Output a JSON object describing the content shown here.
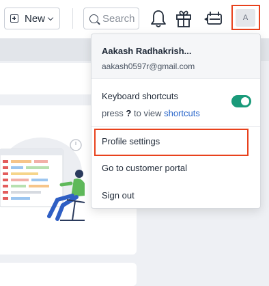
{
  "topbar": {
    "new_label": "New",
    "search_placeholder": "Search",
    "avatar_initial": "A",
    "icons": [
      "plus-square-icon",
      "chevron-down-icon",
      "search-icon",
      "bell-icon",
      "gift-icon",
      "announcement-icon"
    ]
  },
  "menu": {
    "user_name": "Aakash Radhakrish...",
    "user_email": "aakash0597r@gmail.com",
    "keyboard_shortcuts_label": "Keyboard shortcuts",
    "shortcuts_hint": {
      "prefix": "press",
      "key": "?",
      "middle": "to view",
      "link": "shortcuts"
    },
    "shortcuts_enabled": true,
    "items": [
      {
        "label": "Profile settings"
      },
      {
        "label": "Go to customer portal"
      },
      {
        "label": "Sign out"
      }
    ]
  },
  "colors": {
    "highlight": "#e8411c",
    "toggle_on": "#1a9a7a",
    "link": "#2563c9"
  }
}
